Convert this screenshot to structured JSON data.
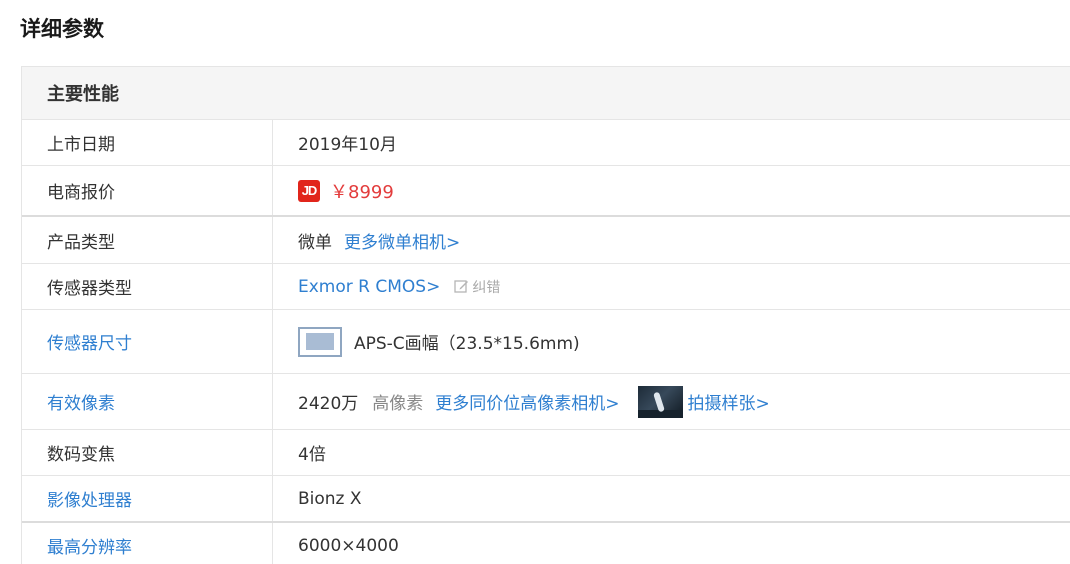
{
  "page": {
    "title": "详细参数"
  },
  "section": {
    "title": "主要性能"
  },
  "rows": {
    "release_date": {
      "label": "上市日期",
      "value": "2019年10月"
    },
    "ecommerce_price": {
      "label": "电商报价",
      "jd_logo": "JD",
      "price": "￥8999"
    },
    "product_type": {
      "label": "产品类型",
      "value": "微单",
      "more_link": "更多微单相机>"
    },
    "sensor_type": {
      "label": "传感器类型",
      "value_link": "Exmor R CMOS>",
      "correction": "纠错"
    },
    "sensor_size": {
      "label": "传感器尺寸",
      "value": "APS-C画幅（23.5*15.6mm)"
    },
    "effective_pixels": {
      "label": "有效像素",
      "value": "2420万",
      "tag": "高像素",
      "more_link": "更多同价位高像素相机>",
      "sample_link": "拍摄样张>"
    },
    "digital_zoom": {
      "label": "数码变焦",
      "value": "4倍"
    },
    "image_processor": {
      "label": "影像处理器",
      "value": "Bionz X"
    },
    "max_resolution": {
      "label": "最高分辨率",
      "value": "6000×4000"
    }
  },
  "icons": {
    "jd": "jd-logo-icon",
    "edit": "edit-icon",
    "sensor": "sensor-size-icon",
    "sample": "sample-photo-thumbnail"
  },
  "colors": {
    "link": "#2f7fd0",
    "price": "#e33c3c",
    "jd_red": "#e1251b",
    "header_bg": "#f5f5f5",
    "border": "#e5e5e5"
  }
}
